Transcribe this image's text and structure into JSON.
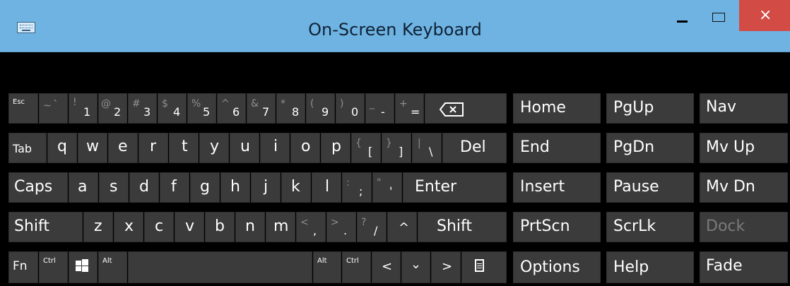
{
  "window": {
    "title": "On-Screen Keyboard",
    "close_label": "×"
  },
  "keys": {
    "esc": "Esc",
    "tilde_top": "~",
    "tilde_main": "`",
    "n1_top": "!",
    "n1_main": "1",
    "n2_top": "@",
    "n2_main": "2",
    "n3_top": "#",
    "n3_main": "3",
    "n4_top": "$",
    "n4_main": "4",
    "n5_top": "%",
    "n5_main": "5",
    "n6_top": "^",
    "n6_main": "6",
    "n7_top": "&",
    "n7_main": "7",
    "n8_top": "*",
    "n8_main": "8",
    "n9_top": "(",
    "n9_main": "9",
    "n0_top": ")",
    "n0_main": "0",
    "minus_top": "_",
    "minus_main": "-",
    "plus_top": "+",
    "plus_main": "=",
    "tab": "Tab",
    "q": "q",
    "w": "w",
    "e": "e",
    "r": "r",
    "t": "t",
    "y": "y",
    "u": "u",
    "i": "i",
    "o": "o",
    "p": "p",
    "lbrace_top": "{",
    "lbrace_main": "[",
    "rbrace_top": "}",
    "rbrace_main": "]",
    "pipe_top": "|",
    "pipe_main": "\\",
    "del": "Del",
    "caps": "Caps",
    "a": "a",
    "s": "s",
    "d": "d",
    "f": "f",
    "g": "g",
    "h": "h",
    "j": "j",
    "k": "k",
    "l": "l",
    "colon_top": ":",
    "colon_main": ";",
    "quote_top": "\"",
    "quote_main": "'",
    "enter": "Enter",
    "shift_left": "Shift",
    "z": "z",
    "x": "x",
    "c": "c",
    "v": "v",
    "b": "b",
    "n": "n",
    "m": "m",
    "lt_top": "<",
    "lt_main": ",",
    "gt_top": ">",
    "gt_main": ".",
    "q_top": "?",
    "q_main": "/",
    "up_arrow": "^",
    "shift_right": "Shift",
    "fn": "Fn",
    "ctrl_left": "Ctrl",
    "alt_left": "Alt",
    "alt_right": "Alt",
    "ctrl_right": "Ctrl",
    "left_arrow": "<",
    "down_arrow": "⌄",
    "right_arrow": ">",
    "home": "Home",
    "pgup": "PgUp",
    "nav": "Nav",
    "end": "End",
    "pgdn": "PgDn",
    "mvup": "Mv Up",
    "insert": "Insert",
    "pause": "Pause",
    "mvdn": "Mv Dn",
    "prtscn": "PrtScn",
    "scrlk": "ScrLk",
    "dock": "Dock",
    "options": "Options",
    "help": "Help",
    "fade": "Fade"
  },
  "colors": {
    "titlebar": "#6fb3e3",
    "key": "#3b3b3b",
    "background": "#000000",
    "close_button": "#d24b45",
    "dim_text": "#7a7a7a"
  }
}
